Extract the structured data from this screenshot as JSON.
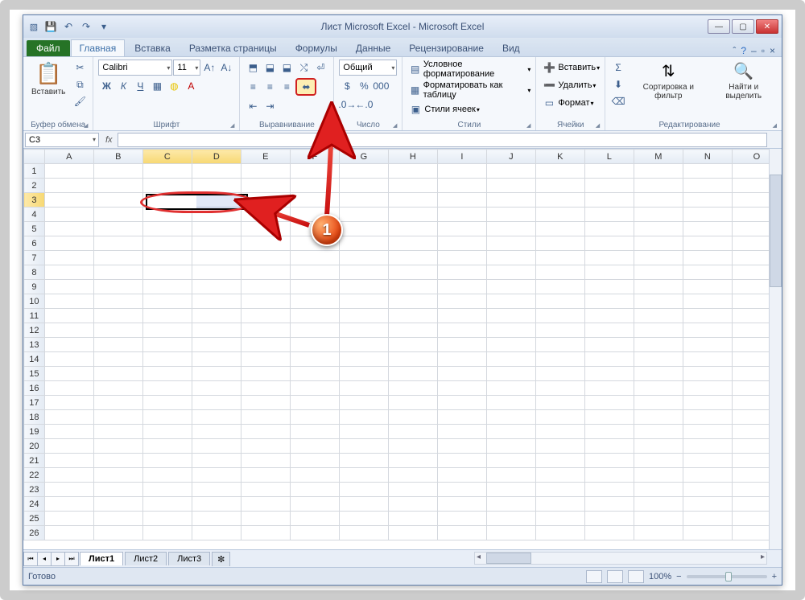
{
  "window": {
    "title": "Лист Microsoft Excel - Microsoft Excel"
  },
  "qat": {
    "save": "💾",
    "undo": "↶",
    "redo": "↷"
  },
  "tabs": {
    "file": "Файл",
    "items": [
      "Главная",
      "Вставка",
      "Разметка страницы",
      "Формулы",
      "Данные",
      "Рецензирование",
      "Вид"
    ],
    "active_index": 0
  },
  "ribbon": {
    "clipboard": {
      "paste": "Вставить",
      "label": "Буфер обмена"
    },
    "font": {
      "name": "Calibri",
      "size": "11",
      "label": "Шрифт",
      "bold": "Ж",
      "italic": "К",
      "underline": "Ч"
    },
    "alignment": {
      "label": "Выравнивание"
    },
    "number": {
      "format": "Общий",
      "label": "Число"
    },
    "styles": {
      "cond": "Условное форматирование",
      "fmt_table": "Форматировать как таблицу",
      "cell_styles": "Стили ячеек",
      "label": "Стили"
    },
    "cells": {
      "insert": "Вставить",
      "delete": "Удалить",
      "format": "Формат",
      "label": "Ячейки"
    },
    "editing": {
      "sort": "Сортировка и фильтр",
      "find": "Найти и выделить",
      "label": "Редактирование"
    }
  },
  "namebox": {
    "value": "C3"
  },
  "columns": [
    "A",
    "B",
    "C",
    "D",
    "E",
    "F",
    "G",
    "H",
    "I",
    "J",
    "K",
    "L",
    "M",
    "N",
    "O"
  ],
  "rows": 26,
  "selection": {
    "ref": "C3:D3",
    "active": "C3"
  },
  "sheet_tabs": {
    "items": [
      "Лист1",
      "Лист2",
      "Лист3"
    ],
    "active_index": 0
  },
  "status": {
    "ready": "Готово",
    "zoom": "100%"
  },
  "annotation": {
    "step": "1"
  }
}
